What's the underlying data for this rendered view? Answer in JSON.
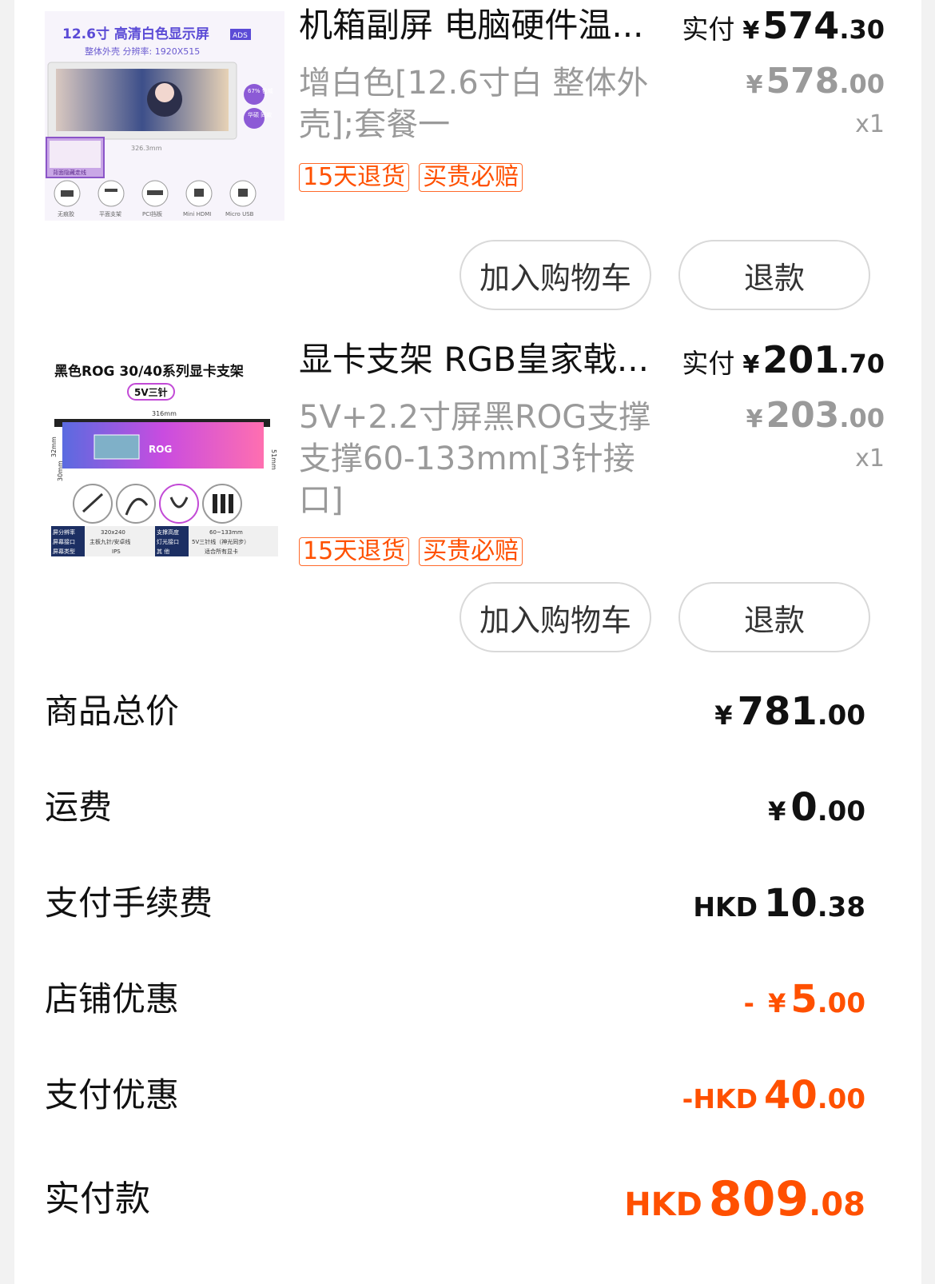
{
  "items": [
    {
      "title": "机箱副屏 电脑硬件温...",
      "paid_label": "实付",
      "paid_currency": "¥",
      "paid_int": "574",
      "paid_dec": ".30",
      "variant": "增白色[12.6寸白 整体外壳];套餐一",
      "orig_currency": "¥",
      "orig_int": "578",
      "orig_dec": ".00",
      "qty": "x1",
      "tags": [
        "15天退货",
        "买贵必赔"
      ],
      "image_text": {
        "headline": "12.6寸  高清白色显示屏",
        "badge": "ADS",
        "sub": "整体外壳  分辨率: 1920X515",
        "chip1": "67% 色域",
        "chip2": "华硕 同款",
        "dim": "326.3mm",
        "inset": "背面隐藏走线",
        "icons": [
          "无痕胶",
          "平面支架",
          "PCI挡板",
          "Mini HDMI",
          "Micro USB"
        ]
      },
      "buttons": [
        "加入购物车",
        "退款"
      ]
    },
    {
      "title": "显卡支架 RGB皇家戟...",
      "paid_label": "实付",
      "paid_currency": "¥",
      "paid_int": "201",
      "paid_dec": ".70",
      "variant": "5V+2.2寸屏黑ROG支撑支撑60-133mm[3针接口]",
      "orig_currency": "¥",
      "orig_int": "203",
      "orig_dec": ".00",
      "qty": "x1",
      "tags": [
        "15天退货",
        "买贵必赔"
      ],
      "image_text": {
        "headline": "黑色ROG 30/40系列显卡支架",
        "pill": "5V三针",
        "dim_top": "316mm",
        "dim_right": "51mm",
        "dim_left": "32mm",
        "dim_left2": "30mm",
        "table": [
          [
            "屏分辨率",
            "320x240",
            "支撑高度",
            "60~133mm"
          ],
          [
            "屏幕接口",
            "主板九针/安卓线",
            "灯光接口",
            "5V三针线（神光同步）"
          ],
          [
            "屏幕类型",
            "IPS",
            "其  他",
            "适合所有显卡"
          ]
        ]
      },
      "buttons": [
        "加入购物车",
        "退款"
      ]
    }
  ],
  "summary": [
    {
      "label": "商品总价",
      "prefix": "",
      "currency": "¥",
      "int": "781",
      "dec": ".00",
      "orange": false
    },
    {
      "label": "运费",
      "prefix": "",
      "currency": "¥",
      "int": "0",
      "dec": ".00",
      "orange": false
    },
    {
      "label": "支付手续费",
      "prefix": "",
      "currency": "HKD",
      "int": "10",
      "dec": ".38",
      "orange": false
    },
    {
      "label": "店铺优惠",
      "prefix": "- ",
      "currency": "¥",
      "int": "5",
      "dec": ".00",
      "orange": true
    },
    {
      "label": "支付优惠",
      "prefix": "-",
      "currency": "HKD",
      "int": "40",
      "dec": ".00",
      "orange": true
    },
    {
      "label": "实付款",
      "prefix": "",
      "currency": "HKD",
      "int": "809",
      "dec": ".08",
      "orange": true
    }
  ],
  "colors": {
    "accent": "#ff5000",
    "muted": "#9a9a9a",
    "background": "#f2f2f2"
  }
}
